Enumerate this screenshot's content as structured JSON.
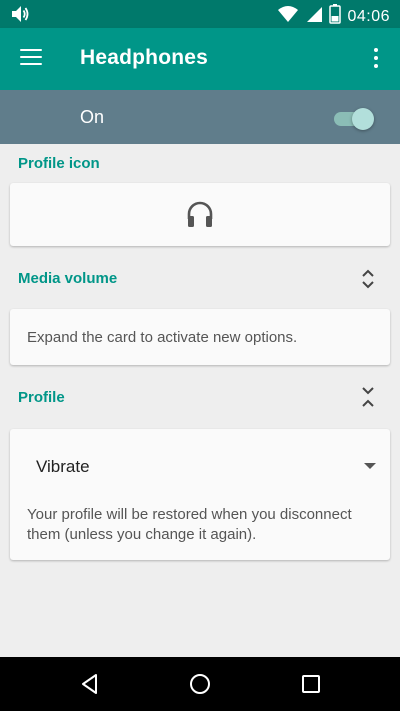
{
  "status_bar": {
    "time": "04:06",
    "icons": [
      "volume-icon",
      "wifi-icon",
      "signal-icon",
      "battery-icon"
    ]
  },
  "app_bar": {
    "title": "Headphones",
    "menu_icon": "hamburger-menu-icon",
    "overflow_icon": "more-vert-icon",
    "color": "#009688"
  },
  "master_switch": {
    "label": "On",
    "checked": true
  },
  "sections": {
    "profile_icon": {
      "title": "Profile icon",
      "icon": "headphones-icon"
    },
    "media_volume": {
      "title": "Media volume",
      "expand_icon": "unfold-more-icon",
      "message": "Expand the card to activate new options."
    },
    "profile": {
      "title": "Profile",
      "expand_icon": "unfold-less-icon",
      "selected": "Vibrate",
      "note": "Your profile will be restored when you disconnect them (unless you change it again)."
    }
  },
  "nav_bar": {
    "buttons": [
      "back-icon",
      "home-icon",
      "recents-icon"
    ]
  }
}
